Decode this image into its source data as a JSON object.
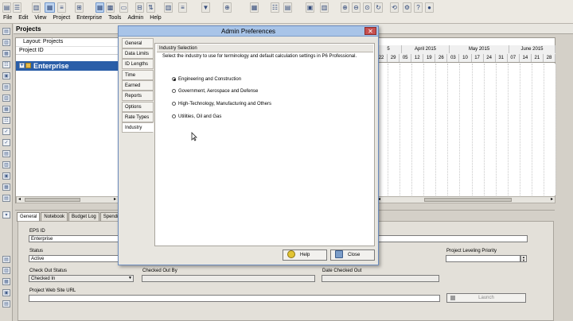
{
  "menubar": [
    "File",
    "Edit",
    "View",
    "Project",
    "Enterprise",
    "Tools",
    "Admin",
    "Help"
  ],
  "projects_window": {
    "title": "Projects",
    "layout_label": "Layout: Projects",
    "column_header": "Project ID",
    "eps_row": "Enterprise"
  },
  "gantt": {
    "months": [
      "5",
      "April 2015",
      "May 2015",
      "June 2015"
    ],
    "days": [
      "22",
      "29",
      "05",
      "12",
      "19",
      "26",
      "03",
      "10",
      "17",
      "24",
      "31",
      "07",
      "14",
      "21",
      "28"
    ]
  },
  "bottom_tabs": [
    "General",
    "Notebook",
    "Budget Log",
    "Spending Pl"
  ],
  "details": {
    "eps_id_label": "EPS ID",
    "eps_id_value": "Enterprise",
    "status_label": "Status",
    "status_value": "Active",
    "leveling_label": "Project Leveling Priority",
    "checkout_status_label": "Check Out Status",
    "checkout_status_value": "Checked In",
    "checked_out_by_label": "Checked Out By",
    "date_checked_out_label": "Date Checked Out",
    "website_label": "Project Web Site URL",
    "launch_label": "Launch"
  },
  "dialog": {
    "title": "Admin Preferences",
    "close_glyph": "✕",
    "tabs": [
      "General",
      "Data Limits",
      "ID Lengths",
      "Time Periods",
      "Earned Value",
      "Reports",
      "Options",
      "Rate Types",
      "Industry"
    ],
    "section_title": "Industry Selection",
    "description": "Select the industry to use for terminology and default calculation settings in P6 Professional.",
    "options": [
      "Engineering and Construction",
      "Government, Aerospace and Defense",
      "High-Technology, Manufacturing and Others",
      "Utilities, Oil and Gas"
    ],
    "selected_option": 0,
    "help_label": "Help",
    "close_label": "Close"
  },
  "colors": {
    "selected_row": "#2a5ea8",
    "dialog_title_bar": "#a8c4e8",
    "close_button": "#c75050"
  }
}
